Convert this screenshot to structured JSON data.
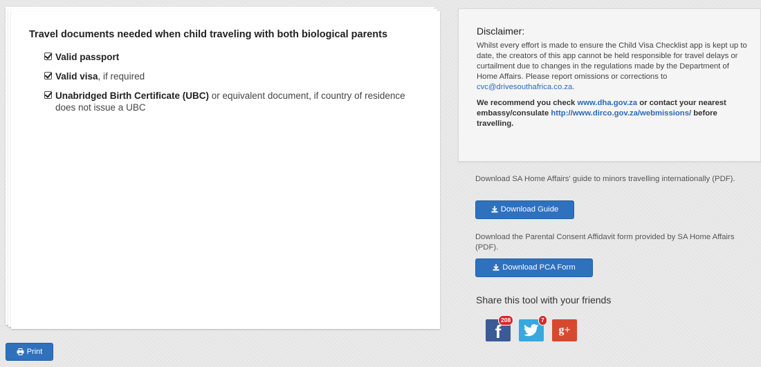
{
  "main_card": {
    "title": "Travel documents needed when child traveling with both biological parents",
    "documents": [
      {
        "bold": "Valid passport",
        "rest": ""
      },
      {
        "bold": "Valid visa",
        "rest": ", if required"
      },
      {
        "bold": "Unabridged Birth Certificate (UBC)",
        "rest": " or equivalent document, if country of residence does not issue a UBC"
      }
    ]
  },
  "print_button": {
    "label": "Print",
    "icon": "printer-icon"
  },
  "disclaimer": {
    "title": "Disclaimer:",
    "text": "Whilst every effort is made to ensure the Child Visa Checklist app is kept up to date, the creators of this app cannot be held responsible for travel delays or curtailment due to changes in the regulations made by the Department of Home Affairs. Please report omissions or corrections to ",
    "email": "cvc@drivesouthafrica.co.za",
    "text_end": ".",
    "rec_1": "We recommend you check ",
    "dha_link": "www.dha.gov.za",
    "rec_2": " or contact your nearest embassy/consulate ",
    "dirco_link": "http://www.dirco.gov.za/webmissions/",
    "rec_3": " before travelling."
  },
  "downloads": {
    "guide_text": "Download SA Home Affairs' guide to minors travelling internationally (PDF).",
    "guide_button": "Download Guide",
    "pca_text": "Download the Parental Consent Affidavit form provided by SA Home Affairs (PDF).",
    "pca_button": "Download PCA Form",
    "button_icon": "download-icon"
  },
  "share": {
    "title": "Share this tool with your friends",
    "facebook_count": "208",
    "twitter_count": "7",
    "facebook_glyph": "f",
    "google_glyph": "g+"
  },
  "colors": {
    "primary_button": "#2f71bd",
    "link": "#2a6ab8",
    "facebook": "#3b5b96",
    "twitter": "#37a8e0",
    "google_plus": "#d7492f",
    "badge": "#d9282a"
  }
}
